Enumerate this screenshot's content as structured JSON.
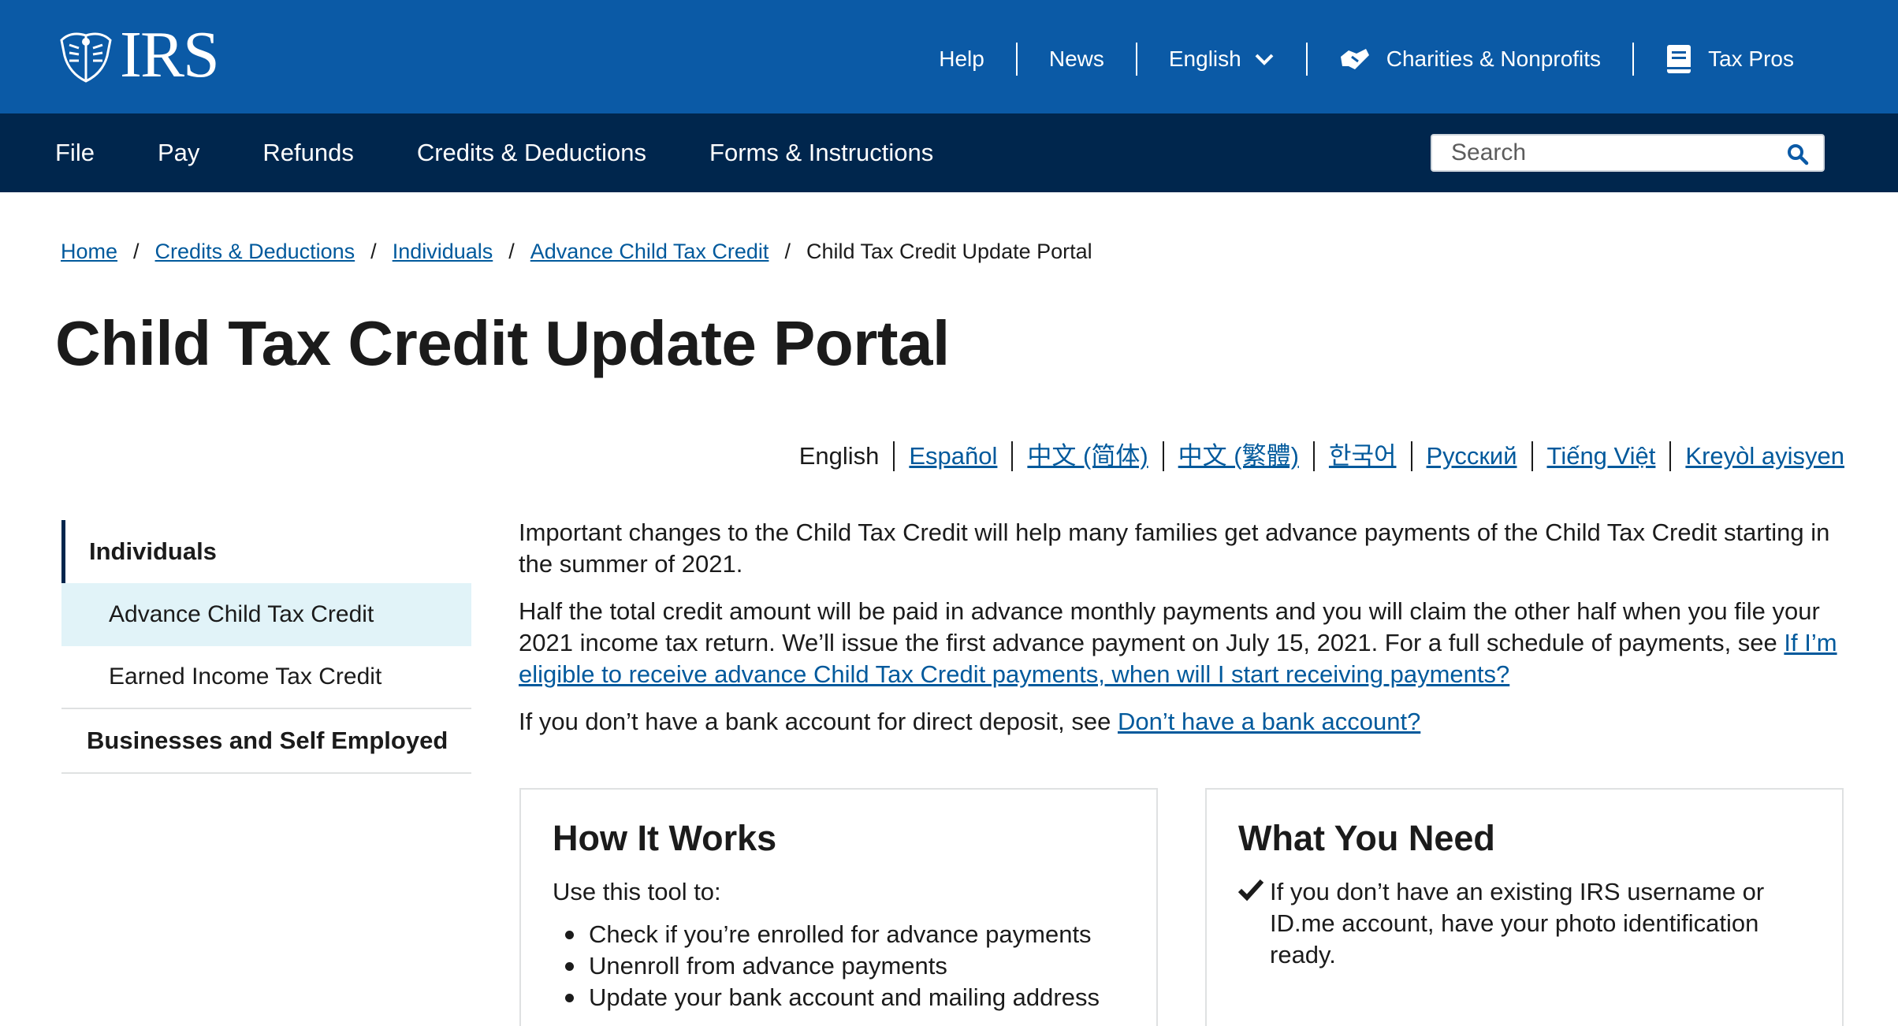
{
  "header": {
    "logo_text": "IRS",
    "util_links": [
      {
        "label": "Help"
      },
      {
        "label": "News"
      },
      {
        "label": "English"
      },
      {
        "label": "Charities & Nonprofits"
      },
      {
        "label": "Tax Pros"
      }
    ]
  },
  "nav": {
    "items": [
      "File",
      "Pay",
      "Refunds",
      "Credits & Deductions",
      "Forms & Instructions"
    ],
    "search_placeholder": "Search"
  },
  "breadcrumb": {
    "items": [
      "Home",
      "Credits & Deductions",
      "Individuals",
      "Advance Child Tax Credit"
    ],
    "current": "Child Tax Credit Update Portal"
  },
  "page_title": "Child Tax Credit Update Portal",
  "languages": [
    "English",
    "Español",
    "中文 (简体)",
    "中文 (繁體)",
    "한국어",
    "Русский",
    "Tiếng Việt",
    "Kreyòl ayisyen"
  ],
  "sidebar": {
    "heading": "Individuals",
    "items": [
      "Advance Child Tax Credit",
      "Earned Income Tax Credit"
    ],
    "bottom": "Businesses and Self Employed"
  },
  "content": {
    "p1": "Important changes to the Child Tax Credit will help many families get advance payments of the Child Tax Credit starting in the summer of 2021.",
    "p2_text": "Half the total credit amount will be paid in advance monthly payments and you will claim the other half when you file your 2021 income tax return. We’ll issue the first advance payment on July 15, 2021. For a full schedule of payments, see ",
    "p2_link": "If I’m eligible to receive advance Child Tax Credit payments, when will I start receiving payments?",
    "p3_text": "If you don’t have a bank account for direct deposit, see ",
    "p3_link": "Don’t have a bank account?"
  },
  "cards": {
    "how": {
      "title": "How It Works",
      "intro": "Use this tool to:",
      "items": [
        "Check if you’re enrolled for advance payments",
        "Unenroll from advance payments",
        "Update your bank account and mailing address"
      ]
    },
    "need": {
      "title": "What You Need",
      "item": "If you don’t have an existing IRS username or ID.me account, have your photo identification ready."
    }
  },
  "colors": {
    "top_bar": "#0b5aa6",
    "main_nav": "#00264d",
    "link": "#00599c",
    "sidebar_active": "#e1f3f8"
  }
}
